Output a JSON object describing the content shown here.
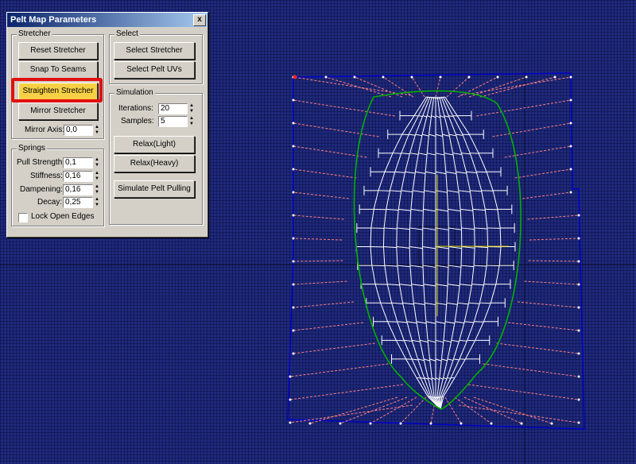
{
  "dialog": {
    "title": "Pelt Map Parameters",
    "close_glyph": "x",
    "stretcher": {
      "title": "Stretcher",
      "reset": "Reset Stretcher",
      "snap": "Snap To Seams",
      "straighten": "Straighten Stretcher",
      "mirror": "Mirror Stretcher",
      "mirror_axis_label": "Mirror Axis:",
      "mirror_axis_value": "0,0"
    },
    "springs": {
      "title": "Springs",
      "pull_label": "Pull Strength:",
      "pull_value": "0,1",
      "stiff_label": "Stiffness:",
      "stiff_value": "0,16",
      "damp_label": "Dampening:",
      "damp_value": "0,16",
      "decay_label": "Decay:",
      "decay_value": "0,25",
      "lock_label": "Lock Open Edges"
    },
    "select": {
      "title": "Select",
      "stretcher": "Select Stretcher",
      "pelt": "Select Pelt UVs"
    },
    "simulation": {
      "title": "Simulation",
      "iter_label": "Iterations:",
      "iter_value": "20",
      "samples_label": "Samples:",
      "samples_value": "5",
      "relax_light": "Relax(Light)",
      "relax_heavy": "Relax(Heavy)",
      "simulate": "Simulate Pelt Pulling"
    }
  },
  "colors": {
    "viewport_bg": "#1f2a7d",
    "highlight": "#e01010",
    "active_button": "#f7d045",
    "stretcher_frame": "#0000c8",
    "pelt_edge": "#00b000",
    "mesh": "#ffffff",
    "springs": "#ff8080",
    "gizmo": "#e0d000"
  }
}
